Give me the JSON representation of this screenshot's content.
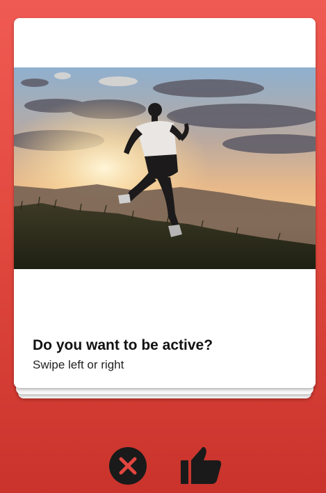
{
  "card": {
    "title": "Do you want to be active?",
    "subtitle": "Swipe left or right",
    "image": "man-running-at-sunset-photo"
  },
  "actions": {
    "dislike_icon": "close-circle-icon",
    "like_icon": "thumbs-up-icon"
  },
  "colors": {
    "background_top": "#ef5a52",
    "background_bottom": "#c9332b",
    "card": "#ffffff",
    "icon": "#1a1a1a"
  }
}
